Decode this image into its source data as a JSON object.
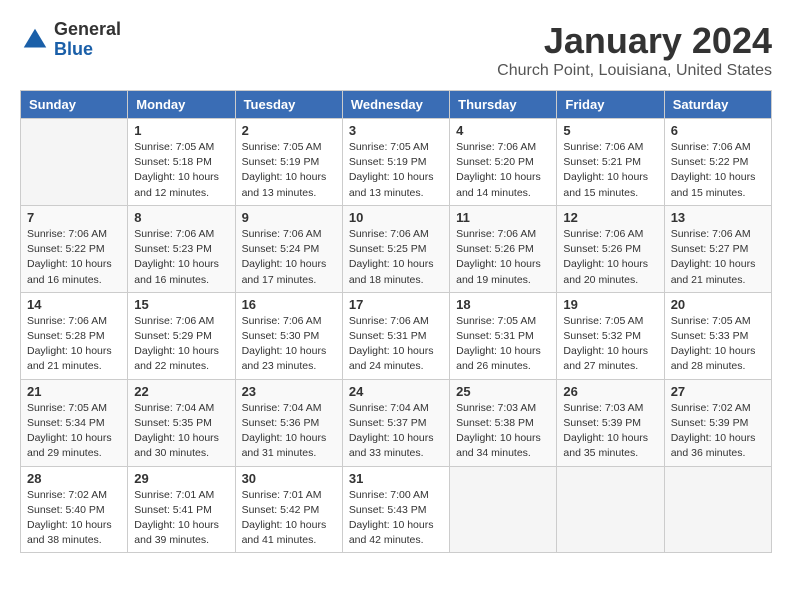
{
  "logo": {
    "general": "General",
    "blue": "Blue"
  },
  "title": "January 2024",
  "location": "Church Point, Louisiana, United States",
  "days_of_week": [
    "Sunday",
    "Monday",
    "Tuesday",
    "Wednesday",
    "Thursday",
    "Friday",
    "Saturday"
  ],
  "weeks": [
    [
      {
        "day": null,
        "content": null
      },
      {
        "day": "1",
        "sunrise": "7:05 AM",
        "sunset": "5:18 PM",
        "daylight": "10 hours and 12 minutes."
      },
      {
        "day": "2",
        "sunrise": "7:05 AM",
        "sunset": "5:19 PM",
        "daylight": "10 hours and 13 minutes."
      },
      {
        "day": "3",
        "sunrise": "7:05 AM",
        "sunset": "5:19 PM",
        "daylight": "10 hours and 13 minutes."
      },
      {
        "day": "4",
        "sunrise": "7:06 AM",
        "sunset": "5:20 PM",
        "daylight": "10 hours and 14 minutes."
      },
      {
        "day": "5",
        "sunrise": "7:06 AM",
        "sunset": "5:21 PM",
        "daylight": "10 hours and 15 minutes."
      },
      {
        "day": "6",
        "sunrise": "7:06 AM",
        "sunset": "5:22 PM",
        "daylight": "10 hours and 15 minutes."
      }
    ],
    [
      {
        "day": "7",
        "sunrise": "7:06 AM",
        "sunset": "5:22 PM",
        "daylight": "10 hours and 16 minutes."
      },
      {
        "day": "8",
        "sunrise": "7:06 AM",
        "sunset": "5:23 PM",
        "daylight": "10 hours and 16 minutes."
      },
      {
        "day": "9",
        "sunrise": "7:06 AM",
        "sunset": "5:24 PM",
        "daylight": "10 hours and 17 minutes."
      },
      {
        "day": "10",
        "sunrise": "7:06 AM",
        "sunset": "5:25 PM",
        "daylight": "10 hours and 18 minutes."
      },
      {
        "day": "11",
        "sunrise": "7:06 AM",
        "sunset": "5:26 PM",
        "daylight": "10 hours and 19 minutes."
      },
      {
        "day": "12",
        "sunrise": "7:06 AM",
        "sunset": "5:26 PM",
        "daylight": "10 hours and 20 minutes."
      },
      {
        "day": "13",
        "sunrise": "7:06 AM",
        "sunset": "5:27 PM",
        "daylight": "10 hours and 21 minutes."
      }
    ],
    [
      {
        "day": "14",
        "sunrise": "7:06 AM",
        "sunset": "5:28 PM",
        "daylight": "10 hours and 21 minutes."
      },
      {
        "day": "15",
        "sunrise": "7:06 AM",
        "sunset": "5:29 PM",
        "daylight": "10 hours and 22 minutes."
      },
      {
        "day": "16",
        "sunrise": "7:06 AM",
        "sunset": "5:30 PM",
        "daylight": "10 hours and 23 minutes."
      },
      {
        "day": "17",
        "sunrise": "7:06 AM",
        "sunset": "5:31 PM",
        "daylight": "10 hours and 24 minutes."
      },
      {
        "day": "18",
        "sunrise": "7:05 AM",
        "sunset": "5:31 PM",
        "daylight": "10 hours and 26 minutes."
      },
      {
        "day": "19",
        "sunrise": "7:05 AM",
        "sunset": "5:32 PM",
        "daylight": "10 hours and 27 minutes."
      },
      {
        "day": "20",
        "sunrise": "7:05 AM",
        "sunset": "5:33 PM",
        "daylight": "10 hours and 28 minutes."
      }
    ],
    [
      {
        "day": "21",
        "sunrise": "7:05 AM",
        "sunset": "5:34 PM",
        "daylight": "10 hours and 29 minutes."
      },
      {
        "day": "22",
        "sunrise": "7:04 AM",
        "sunset": "5:35 PM",
        "daylight": "10 hours and 30 minutes."
      },
      {
        "day": "23",
        "sunrise": "7:04 AM",
        "sunset": "5:36 PM",
        "daylight": "10 hours and 31 minutes."
      },
      {
        "day": "24",
        "sunrise": "7:04 AM",
        "sunset": "5:37 PM",
        "daylight": "10 hours and 33 minutes."
      },
      {
        "day": "25",
        "sunrise": "7:03 AM",
        "sunset": "5:38 PM",
        "daylight": "10 hours and 34 minutes."
      },
      {
        "day": "26",
        "sunrise": "7:03 AM",
        "sunset": "5:39 PM",
        "daylight": "10 hours and 35 minutes."
      },
      {
        "day": "27",
        "sunrise": "7:02 AM",
        "sunset": "5:39 PM",
        "daylight": "10 hours and 36 minutes."
      }
    ],
    [
      {
        "day": "28",
        "sunrise": "7:02 AM",
        "sunset": "5:40 PM",
        "daylight": "10 hours and 38 minutes."
      },
      {
        "day": "29",
        "sunrise": "7:01 AM",
        "sunset": "5:41 PM",
        "daylight": "10 hours and 39 minutes."
      },
      {
        "day": "30",
        "sunrise": "7:01 AM",
        "sunset": "5:42 PM",
        "daylight": "10 hours and 41 minutes."
      },
      {
        "day": "31",
        "sunrise": "7:00 AM",
        "sunset": "5:43 PM",
        "daylight": "10 hours and 42 minutes."
      },
      {
        "day": null,
        "content": null
      },
      {
        "day": null,
        "content": null
      },
      {
        "day": null,
        "content": null
      }
    ]
  ],
  "labels": {
    "sunrise": "Sunrise:",
    "sunset": "Sunset:",
    "daylight": "Daylight:"
  }
}
